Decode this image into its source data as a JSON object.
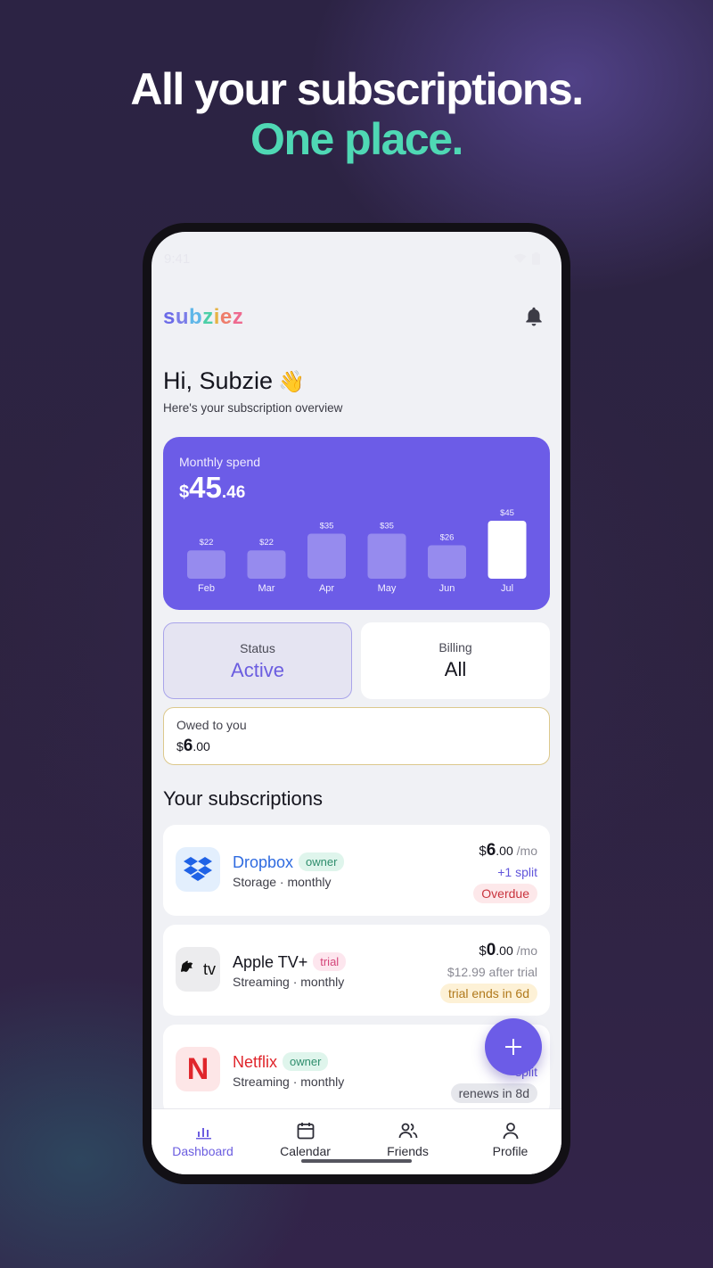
{
  "headline": {
    "line1": "All your subscriptions.",
    "line2": "One place."
  },
  "status_bar": {
    "time": "9:41",
    "icons": [
      "wifi-icon",
      "battery-icon"
    ]
  },
  "app": {
    "logo_letters": [
      "s",
      "u",
      "b",
      "z",
      "i",
      "e",
      "z"
    ],
    "notifications_icon": "bell-icon"
  },
  "greeting": {
    "title": "Hi, Subzie",
    "emoji": "👋",
    "subtitle": "Here's your subscription overview"
  },
  "monthly_spend": {
    "label": "Monthly spend",
    "currency": "$",
    "integer": "45",
    "decimal": ".46"
  },
  "chart_data": {
    "type": "bar",
    "categories": [
      "Feb",
      "Mar",
      "Apr",
      "May",
      "Jun",
      "Jul"
    ],
    "values": [
      22,
      22,
      35,
      35,
      26,
      45
    ],
    "value_labels": [
      "$22",
      "$22",
      "$35",
      "$35",
      "$26",
      "$45"
    ],
    "highlighted_category": "Jul",
    "title": "",
    "xlabel": "",
    "ylabel": "",
    "ylim": [
      0,
      45
    ],
    "grid": false,
    "colors": {
      "bar": "#a49bf0",
      "highlight": "#ffffff",
      "card": "#6c5ce7"
    }
  },
  "filters": {
    "status": {
      "label": "Status",
      "value": "Active"
    },
    "billing": {
      "label": "Billing",
      "value": "All"
    }
  },
  "owed": {
    "label": "Owed to you",
    "currency": "$",
    "integer": "6",
    "decimal": ".00"
  },
  "subscriptions_title": "Your subscriptions",
  "subscriptions": [
    {
      "name": "Dropbox",
      "name_color": "#2f6be0",
      "role": "owner",
      "meta": "Storage · monthly",
      "currency": "$",
      "integer": "6",
      "decimal": ".00",
      "period": " /mo",
      "line2": "+1 split",
      "badge": "Overdue",
      "icon": "dropbox-icon"
    },
    {
      "name": "Apple TV+",
      "name_color": "#15151e",
      "role": "trial",
      "meta": "Streaming · monthly",
      "currency": "$",
      "integer": "0",
      "decimal": ".00",
      "period": " /mo",
      "line2": "$12.99 after trial",
      "badge": "trial ends in 6d",
      "icon": "apple-tv-icon",
      "icon_text": "tv"
    },
    {
      "name": "Netflix",
      "name_color": "#e0252b",
      "role": "owner",
      "meta": "Streaming · monthly",
      "currency": "$",
      "integer": "",
      "decimal": "",
      "period": "",
      "line2": "split",
      "badge": "renews in 8d",
      "icon": "netflix-icon",
      "icon_text": "N"
    }
  ],
  "fab_icon": "plus-icon",
  "nav": [
    {
      "label": "Dashboard",
      "icon": "bar-chart-icon",
      "active": true
    },
    {
      "label": "Calendar",
      "icon": "calendar-icon",
      "active": false
    },
    {
      "label": "Friends",
      "icon": "friends-icon",
      "active": false
    },
    {
      "label": "Profile",
      "icon": "profile-icon",
      "active": false
    }
  ]
}
